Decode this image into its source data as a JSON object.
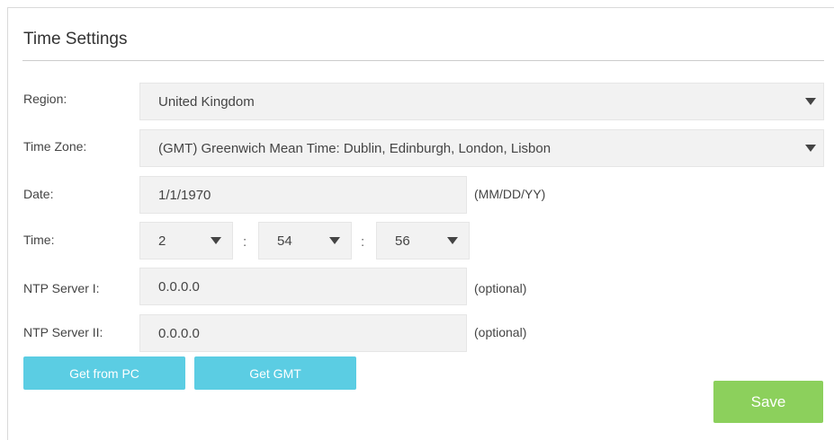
{
  "page": {
    "title": "Time Settings"
  },
  "region": {
    "label": "Region:",
    "value": "United Kingdom"
  },
  "timezone": {
    "label": "Time Zone:",
    "value": "(GMT) Greenwich Mean Time: Dublin, Edinburgh, London, Lisbon"
  },
  "date": {
    "label": "Date:",
    "value": "1/1/1970",
    "hint": "(MM/DD/YY)"
  },
  "time": {
    "label": "Time:",
    "hour": "2",
    "minute": "54",
    "second": "56",
    "separator": ":"
  },
  "ntp1": {
    "label": "NTP Server I:",
    "value": "0.0.0.0",
    "hint": "(optional)"
  },
  "ntp2": {
    "label": "NTP Server II:",
    "value": "0.0.0.0",
    "hint": "(optional)"
  },
  "buttons": {
    "get_from_pc": "Get from PC",
    "get_gmt": "Get GMT",
    "save": "Save"
  },
  "colors": {
    "accent_blue": "#5bcde3",
    "save_green": "#8cd05c",
    "field_bg": "#f2f2f2"
  }
}
